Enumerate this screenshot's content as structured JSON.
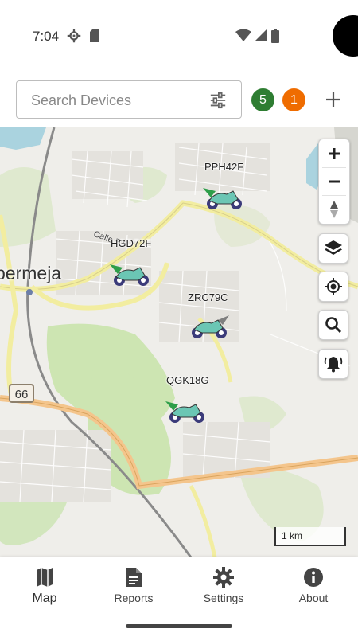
{
  "status_bar": {
    "time": "7:04"
  },
  "search": {
    "placeholder": "Search Devices"
  },
  "badges": {
    "online_count": "5",
    "offline_count": "1"
  },
  "map": {
    "city_label": "bermeja",
    "street_label": "Calle 53",
    "route_number": "66",
    "scale_label": "1 km",
    "vehicles": [
      {
        "plate": "PPH42F",
        "status_color": "#2e9e4a",
        "icon": "motorcycle-icon"
      },
      {
        "plate": "HGD72F",
        "status_color": "#2e9e4a",
        "icon": "motorcycle-icon"
      },
      {
        "plate": "ZRC79C",
        "status_color": "#7f7f7f",
        "icon": "motorcycle-icon"
      },
      {
        "plate": "QGK18G",
        "status_color": "#2e9e4a",
        "icon": "motorcycle-icon"
      }
    ]
  },
  "nav": {
    "items": [
      {
        "label": "Map",
        "icon": "map-icon"
      },
      {
        "label": "Reports",
        "icon": "document-icon"
      },
      {
        "label": "Settings",
        "icon": "gear-icon"
      },
      {
        "label": "About",
        "icon": "info-icon"
      }
    ]
  },
  "colors": {
    "online": "#2e7d32",
    "offline": "#ef6c00",
    "main_road": "#f2eda0",
    "highway": "#f4c58c",
    "green_area": "#cde5b2",
    "water": "#aad3df"
  }
}
